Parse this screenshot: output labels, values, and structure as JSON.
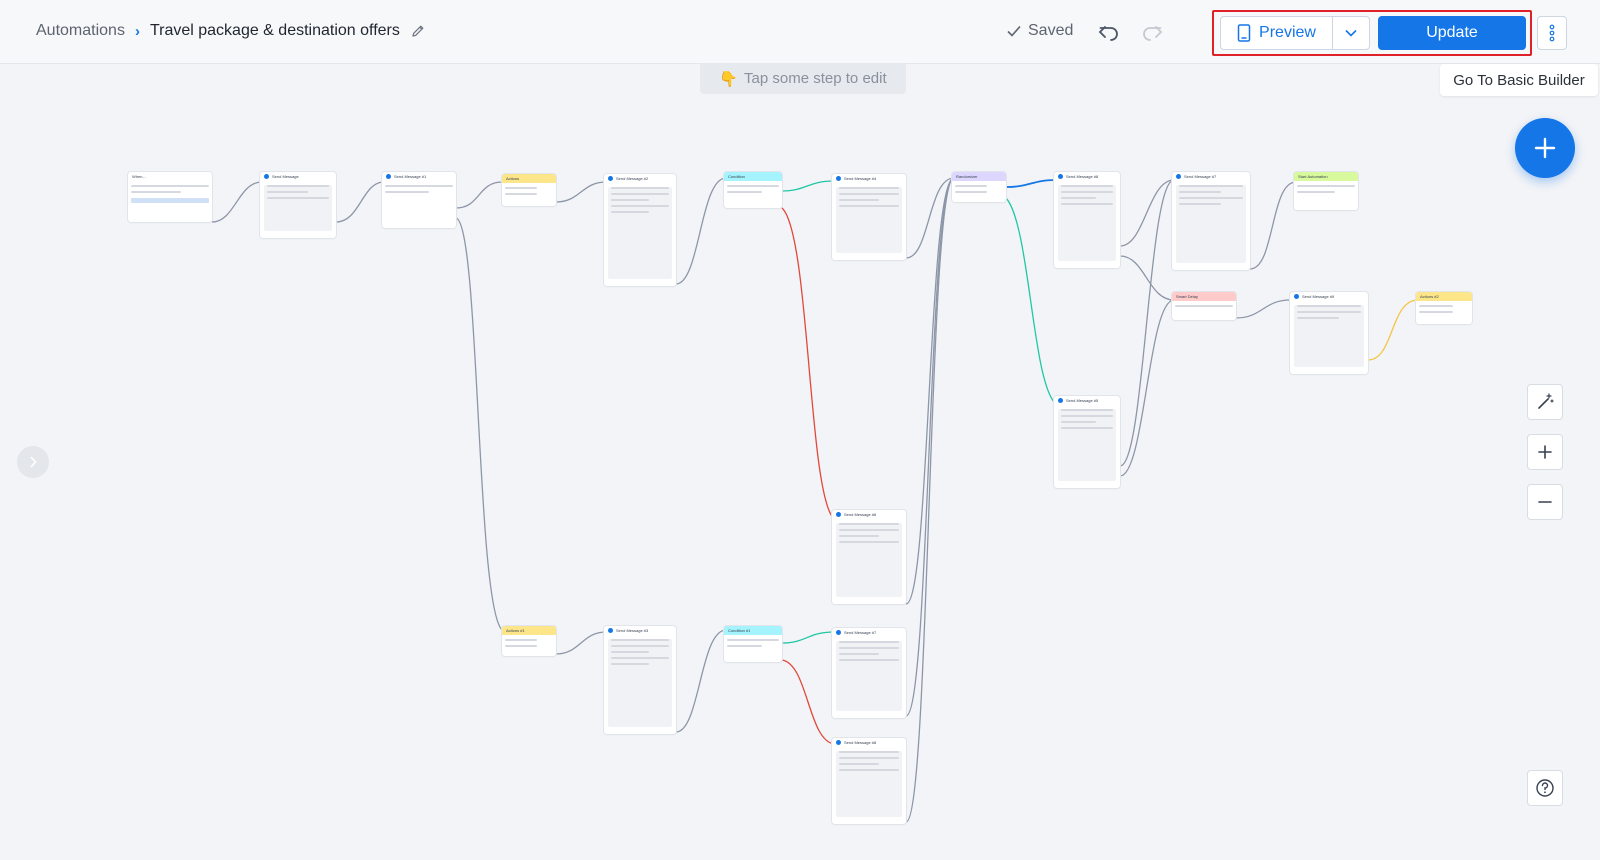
{
  "breadcrumb": {
    "root": "Automations",
    "separator": "›",
    "current": "Travel package & destination offers"
  },
  "status": {
    "saved_label": "Saved"
  },
  "toolbar": {
    "preview_label": "Preview",
    "update_label": "Update",
    "basic_builder_label": "Go To Basic Builder"
  },
  "hint": {
    "emoji": "👇",
    "text": "Tap some step to edit"
  },
  "colors": {
    "accent": "#1576e8",
    "highlight_box": "#e0212a",
    "edge_gray": "#8c96a8",
    "edge_red": "#e2473b",
    "edge_teal": "#1fc7a5",
    "edge_blue": "#1576e8",
    "edge_yellow": "#f5c542"
  },
  "canvas": {
    "nodes": [
      {
        "id": "trigger",
        "kind": "trigger",
        "title": "When..."
      },
      {
        "id": "msg1",
        "kind": "message",
        "title": "Send Message"
      },
      {
        "id": "msg2",
        "kind": "message",
        "title": "Send Message #1"
      },
      {
        "id": "action1",
        "kind": "action",
        "title": "Actions"
      },
      {
        "id": "msg3",
        "kind": "message",
        "title": "Send Message #2"
      },
      {
        "id": "cond1",
        "kind": "condition",
        "title": "Condition"
      },
      {
        "id": "msg4",
        "kind": "message",
        "title": "Send Message #4"
      },
      {
        "id": "random",
        "kind": "randomizer",
        "title": "Randomizer"
      },
      {
        "id": "msg5",
        "kind": "message",
        "title": "Send Message #8"
      },
      {
        "id": "msg6",
        "kind": "message",
        "title": "Send Message #7"
      },
      {
        "id": "start_auto",
        "kind": "start",
        "title": "Start Automation"
      },
      {
        "id": "smart_delay",
        "kind": "delay",
        "title": "Smart Delay"
      },
      {
        "id": "msg7",
        "kind": "message",
        "title": "Send Message #9"
      },
      {
        "id": "actions2",
        "kind": "action",
        "title": "Actions #2"
      },
      {
        "id": "msg8",
        "kind": "message",
        "title": "Send Message #5"
      },
      {
        "id": "msg9",
        "kind": "message",
        "title": "Send Message #6"
      },
      {
        "id": "action3",
        "kind": "action",
        "title": "Actions #1"
      },
      {
        "id": "msg10",
        "kind": "message",
        "title": "Send Message #3"
      },
      {
        "id": "cond2",
        "kind": "condition",
        "title": "Condition #1"
      },
      {
        "id": "msg11",
        "kind": "message",
        "title": "Send Message #7"
      },
      {
        "id": "msg12",
        "kind": "message",
        "title": "Send Message #8"
      }
    ]
  },
  "controls": {
    "add_icon": "plus-icon",
    "magic_icon": "magic-wand-icon",
    "zoom_in_icon": "zoom-in-icon",
    "zoom_out_icon": "zoom-out-icon",
    "help_icon": "help-icon",
    "expand_icon": "chevron-right-icon"
  }
}
